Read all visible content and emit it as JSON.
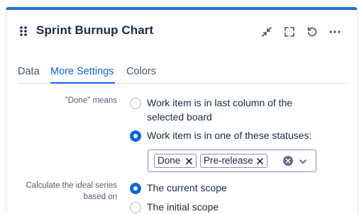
{
  "header": {
    "title": "Sprint Burnup Chart",
    "icons": [
      "drag-handle-icon",
      "minimize-icon",
      "fullscreen-icon",
      "refresh-icon",
      "more-icon"
    ]
  },
  "tabs": [
    {
      "label": "Data",
      "active": false
    },
    {
      "label": "More Settings",
      "active": true
    },
    {
      "label": "Colors",
      "active": false
    }
  ],
  "done_setting": {
    "label": "\"Done\" means",
    "options": [
      {
        "line1": "Work item is in last column of the",
        "line2": "selected board",
        "checked": false
      },
      {
        "line1": "Work item is in one of these statuses:",
        "checked": true
      }
    ],
    "statuses": [
      "Done",
      "Pre-release"
    ]
  },
  "ideal_setting": {
    "label_line1": "Calculate the ideal series",
    "label_line2": "based on",
    "options": [
      {
        "label": "The current scope",
        "checked": true
      },
      {
        "label": "The initial scope",
        "checked": false
      }
    ]
  },
  "colors": {
    "accent": "#0c66e4",
    "border_top": "#1f6fd6",
    "text": "#172b4d"
  }
}
